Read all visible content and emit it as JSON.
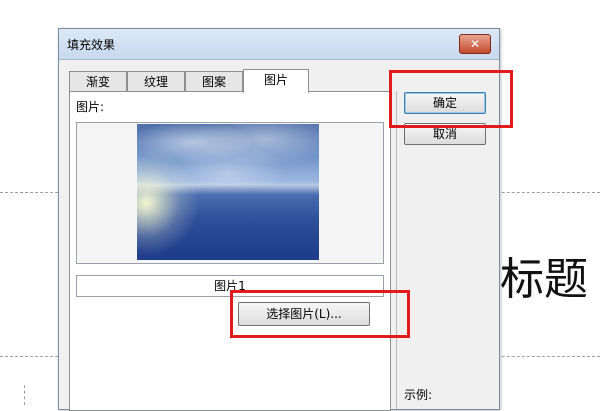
{
  "slide": {
    "title_fragment": "标题"
  },
  "dialog": {
    "title": "填充效果",
    "close_symbol": "✕",
    "tabs": [
      {
        "label": "渐变"
      },
      {
        "label": "纹理"
      },
      {
        "label": "图案"
      },
      {
        "label": "图片",
        "active": true
      }
    ],
    "picture_label": "图片:",
    "picture_name": "图片1",
    "select_picture_button": "选择图片(L)...",
    "ok_button": "确定",
    "cancel_button": "取消",
    "example_label": "示例:"
  },
  "annotations": {
    "highlight_color": "#e31a1c"
  }
}
